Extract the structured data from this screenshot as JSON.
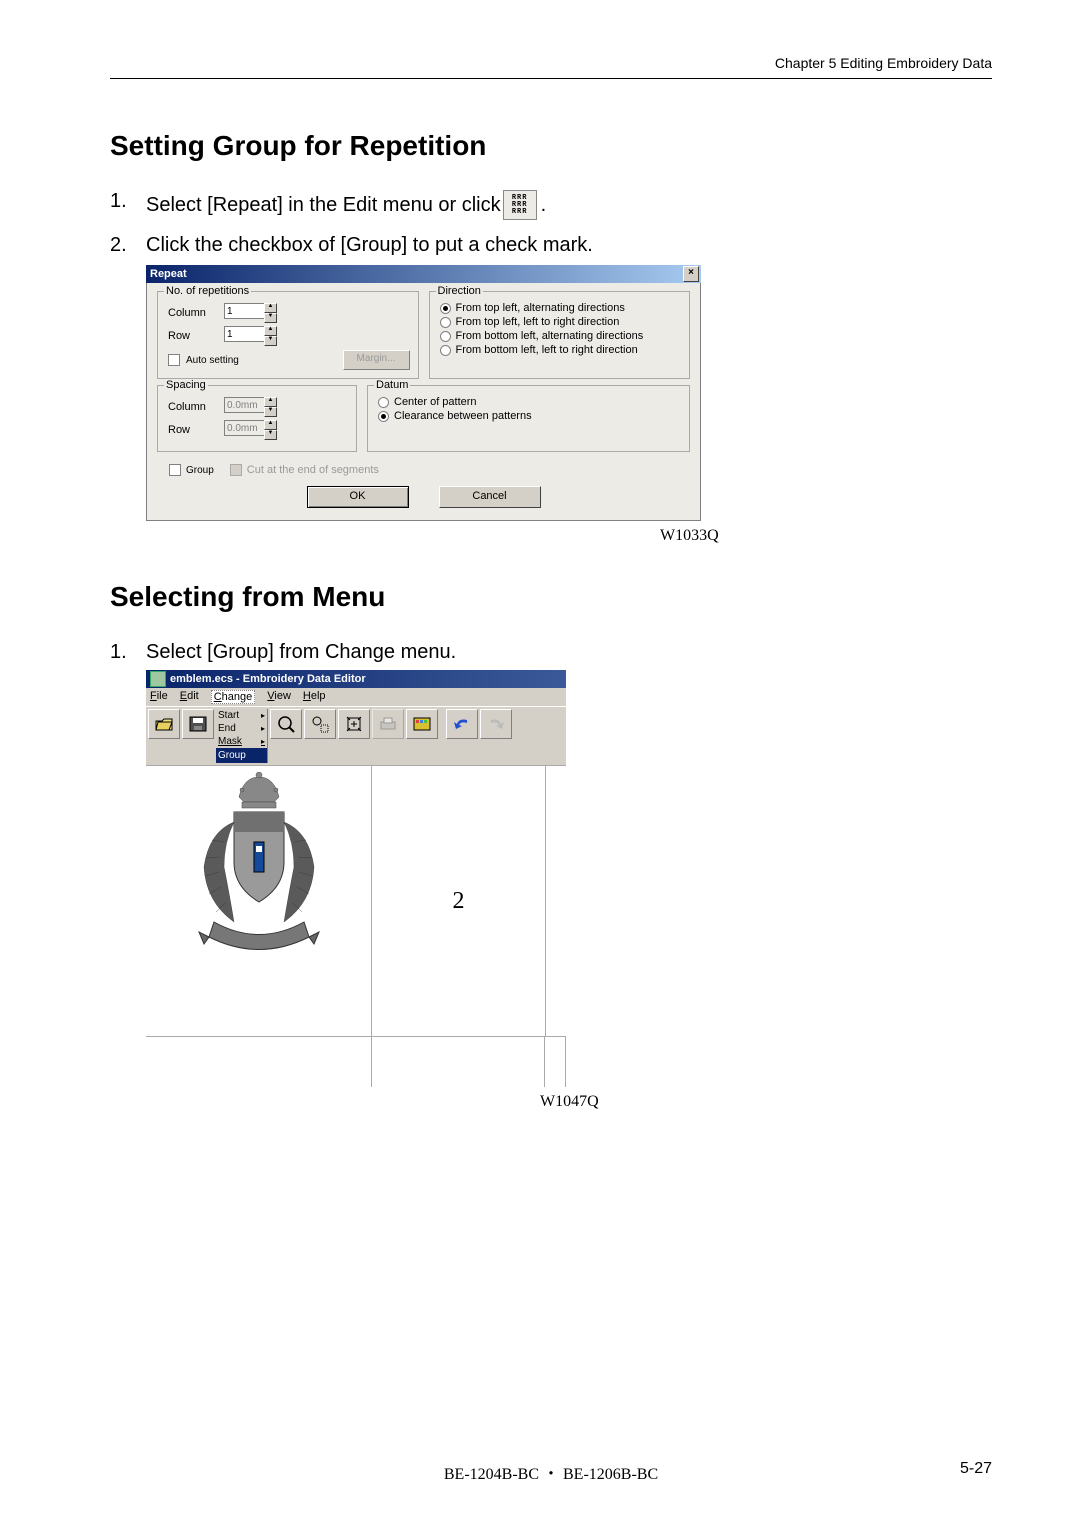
{
  "header": {
    "chapter": "Chapter 5   Editing Embroidery Data"
  },
  "section1": {
    "title": "Setting Group for Repetition",
    "step1_a": "Select [Repeat] in the Edit menu or click ",
    "repeat_icon": "RRR\nRRR\nRRR",
    "step1_b": ".",
    "step2": "Click the checkbox of [Group] to put a check mark.",
    "fig": "W1033Q"
  },
  "dialog1": {
    "title": "Repeat",
    "close": "×",
    "no_of_reps": {
      "legend": "No. of repetitions",
      "column_label": "Column",
      "column_value": "1",
      "row_label": "Row",
      "row_value": "1",
      "auto_setting": "Auto setting",
      "margin_btn": "Margin..."
    },
    "direction": {
      "legend": "Direction",
      "opt1": "From top left, alternating directions",
      "opt2": "From top left, left to right direction",
      "opt3": "From bottom left, alternating directions",
      "opt4": "From bottom left, left to right direction"
    },
    "spacing": {
      "legend": "Spacing",
      "column_label": "Column",
      "column_value": "0.0mm",
      "row_label": "Row",
      "row_value": "0.0mm"
    },
    "datum": {
      "legend": "Datum",
      "opt1": "Center of pattern",
      "opt2": "Clearance between patterns"
    },
    "group": {
      "group_label": "Group",
      "cut_label": "Cut at the end of segments"
    },
    "ok": "OK",
    "cancel": "Cancel"
  },
  "section2": {
    "title": "Selecting from Menu",
    "step1": "Select [Group] from Change menu.",
    "fig": "W1047Q"
  },
  "editor": {
    "title": "emblem.ecs - Embroidery Data Editor",
    "menu": {
      "file": "File",
      "edit": "Edit",
      "change": "Change",
      "view": "View",
      "help": "Help"
    },
    "dropdown": {
      "start": "Start",
      "end": "End",
      "mask": "Mask",
      "group": "Group"
    },
    "canvas_num": "2"
  },
  "footer": {
    "center": "BE-1204B-BC ・ BE-1206B-BC",
    "right": "5-27"
  },
  "step_numbers": {
    "one": "1.",
    "two": "2."
  }
}
